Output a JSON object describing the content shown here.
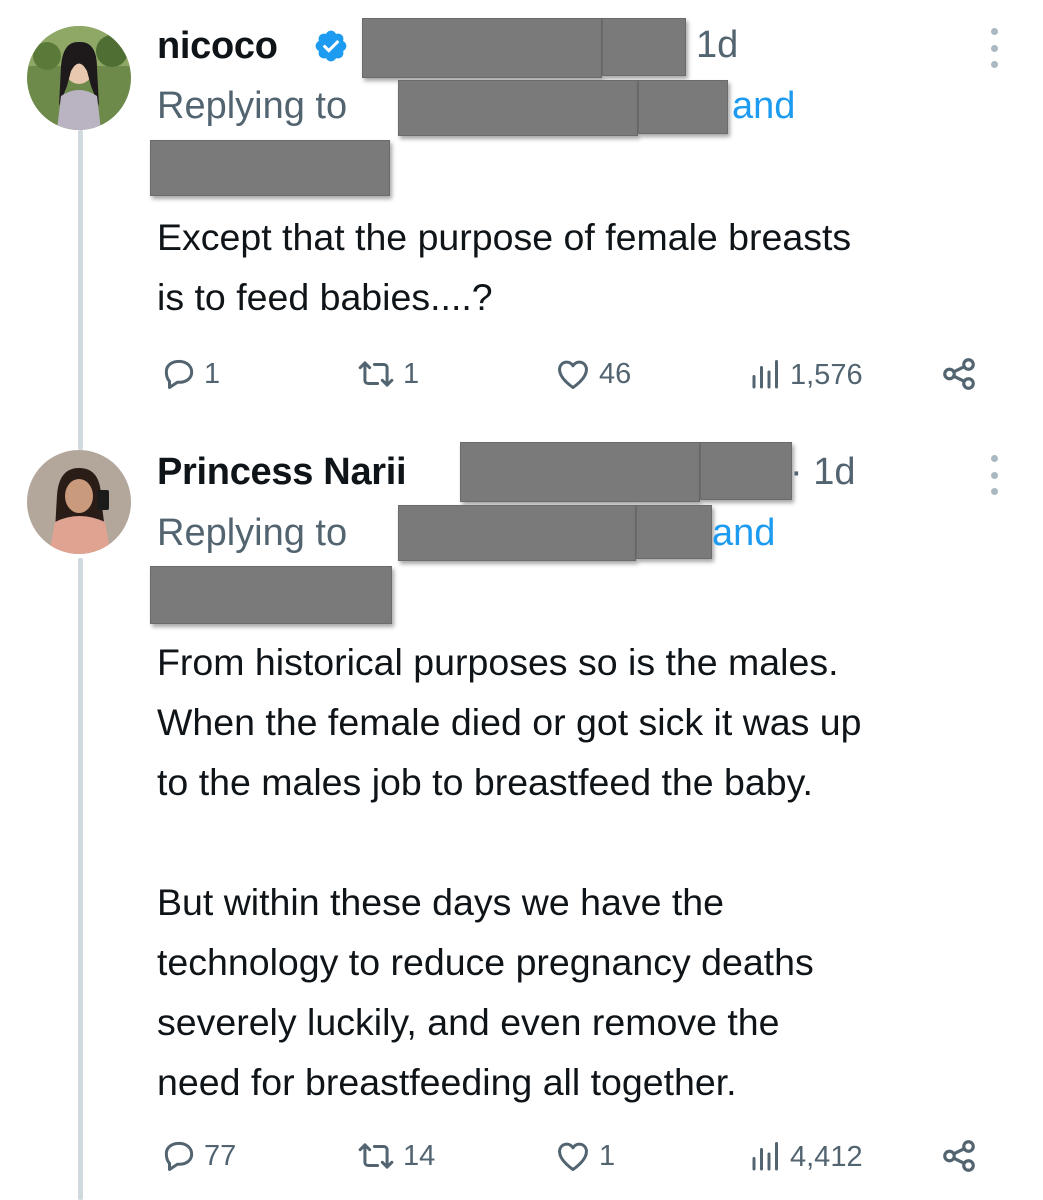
{
  "colors": {
    "text": "#0f1419",
    "secondary": "#536471",
    "link": "#1d9bf0",
    "verified": "#1d9bf0",
    "redaction": "#7a7a7a"
  },
  "tweets": [
    {
      "author": "nicoco",
      "verified": true,
      "time": "1d",
      "replying_to_label": "Replying to",
      "and_label": "and",
      "text": "Except that the purpose of female breasts\nis to feed babies....?",
      "actions": {
        "replies": "1",
        "reposts": "1",
        "likes": "46",
        "views": "1,576"
      }
    },
    {
      "author": "Princess Narii",
      "verified": false,
      "time": "· 1d",
      "replying_to_label": "Replying to",
      "and_label": "and",
      "text": "From historical purposes so is the males.\nWhen the female died or got sick it was up\nto the males job to breastfeed the baby.\n\nBut within these days we have the\ntechnology to reduce pregnancy deaths\nseverely luckily, and even remove the\nneed for breastfeeding all together.",
      "actions": {
        "replies": "77",
        "reposts": "14",
        "likes": "1",
        "views": "4,412"
      }
    }
  ],
  "icons": [
    "reply-icon",
    "repost-icon",
    "like-icon",
    "views-icon",
    "share-icon",
    "more-icon",
    "verified-badge-icon"
  ]
}
